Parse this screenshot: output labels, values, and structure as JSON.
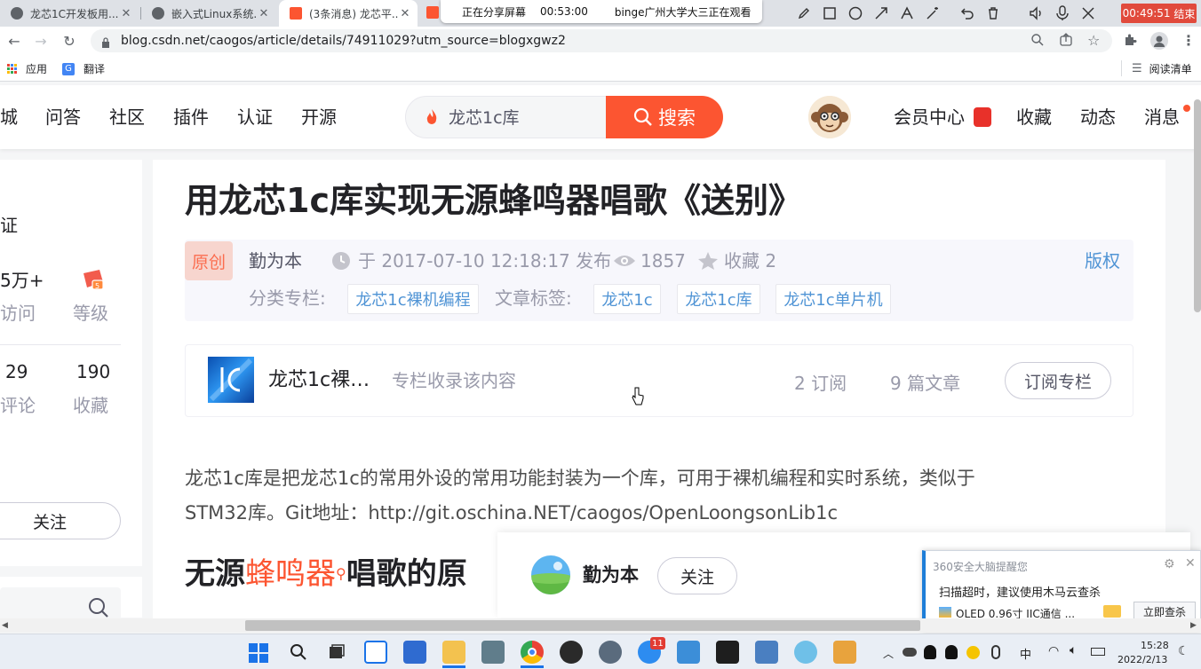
{
  "browser": {
    "tabs": [
      {
        "label": "龙芯1C开发板用...",
        "active": false
      },
      {
        "label": "嵌入式Linux系统...",
        "active": false
      },
      {
        "label": "(3条消息) 龙芯平...",
        "active": true
      }
    ],
    "url": "blog.csdn.net/caogos/article/details/74911029?utm_source=blogxgwz2",
    "bookmarks": {
      "apps": "应用",
      "translate": "翻译",
      "reading_list": "阅读清单"
    }
  },
  "screen_share": {
    "status": "正在分享屏幕",
    "elapsed": "00:53:00",
    "viewer": "binge广州大学大三正在观看",
    "timer": "00:49:51",
    "end_label": "结束"
  },
  "site_header": {
    "nav": [
      "城",
      "问答",
      "社区",
      "插件",
      "认证",
      "开源"
    ],
    "search_value": "龙芯1c库",
    "search_button": "搜索",
    "right": [
      "会员中心",
      "收藏",
      "动态",
      "消息"
    ]
  },
  "sidebar": {
    "cert_partial": "证",
    "visits_value": "5万+",
    "visits_label": "访问",
    "level_label": "等级",
    "comments_value": "29",
    "comments_label": "评论",
    "favorites_value": "190",
    "favorites_label": "收藏",
    "follow_button": "关注"
  },
  "article": {
    "title": "用龙芯1c库实现无源蜂鸣器唱歌《送别》",
    "original_badge": "原创",
    "author": "勤为本",
    "published": "于 2017-07-10 12:18:17 发布",
    "views": "1857",
    "favorites": "收藏 2",
    "copyright": "版权",
    "category_label": "分类专栏:",
    "category_tag": "龙芯1c裸机编程",
    "tags_label": "文章标签:",
    "tags": [
      "龙芯1c",
      "龙芯1c库",
      "龙芯1c单片机"
    ],
    "column": {
      "name": "龙芯1c裸…",
      "note": "专栏收录该内容",
      "subscribers": "2 订阅",
      "articles": "9 篇文章",
      "subscribe_button": "订阅专栏"
    },
    "body_line1": "龙芯1c库是把龙芯1c的常用外设的常用功能封装为一个库，可用于裸机编程和实时系统，类似于",
    "body_line2": "STM32库。Git地址：http://git.oschina.NET/caogos/OpenLoongsonLib1c",
    "heading2_a": "无源",
    "heading2_link": "蜂鸣器",
    "heading2_b": "唱歌的原"
  },
  "author_bar": {
    "name": "勤为本",
    "follow": "关注"
  },
  "popup": {
    "title": "360安全大脑提醒您",
    "message": "扫描超时，建议使用木马云查杀",
    "file": "OLED 0.96寸 IIC通信 ...",
    "button": "立即查杀"
  },
  "taskbar": {
    "ime": "中",
    "time": "15:28",
    "date": "2022/2/13",
    "badge": "11"
  },
  "colors": {
    "brand": "#fc5531",
    "link": "#5094d5",
    "end_button": "#e14a3c"
  }
}
